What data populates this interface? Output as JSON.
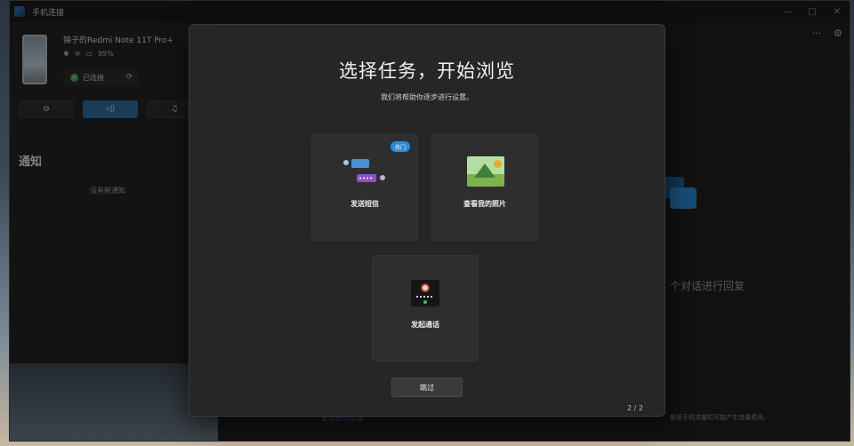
{
  "window": {
    "title": "手机连接",
    "controls": [
      "—",
      "□",
      "✕"
    ]
  },
  "device": {
    "name": "锦子的Redmi Note 11T Pro+",
    "battery": "95%",
    "connection_status": "已连接"
  },
  "notifications": {
    "title": "通知",
    "empty_text": "没有新通知"
  },
  "right_panel": {
    "conversation_hint": "个对话进行回复",
    "bottom_left_link": "更改启动设置",
    "bottom_right_note": "使用手机流量时可能产生流量费用。"
  },
  "modal": {
    "title": "选择任务，开始浏览",
    "subtitle": "我们将帮助你逐步进行设置。",
    "cards": [
      {
        "label": "发送短信",
        "badge": "热门",
        "icon": "sms-icon"
      },
      {
        "label": "查看我的照片",
        "icon": "photos-icon"
      },
      {
        "label": "发起通话",
        "icon": "call-icon"
      }
    ],
    "skip_label": "跳过",
    "page_indicator": "2 / 2"
  },
  "colors": {
    "accent": "#2f6fa3",
    "badge": "#2f8ad6",
    "connected": "#3fae5a"
  }
}
